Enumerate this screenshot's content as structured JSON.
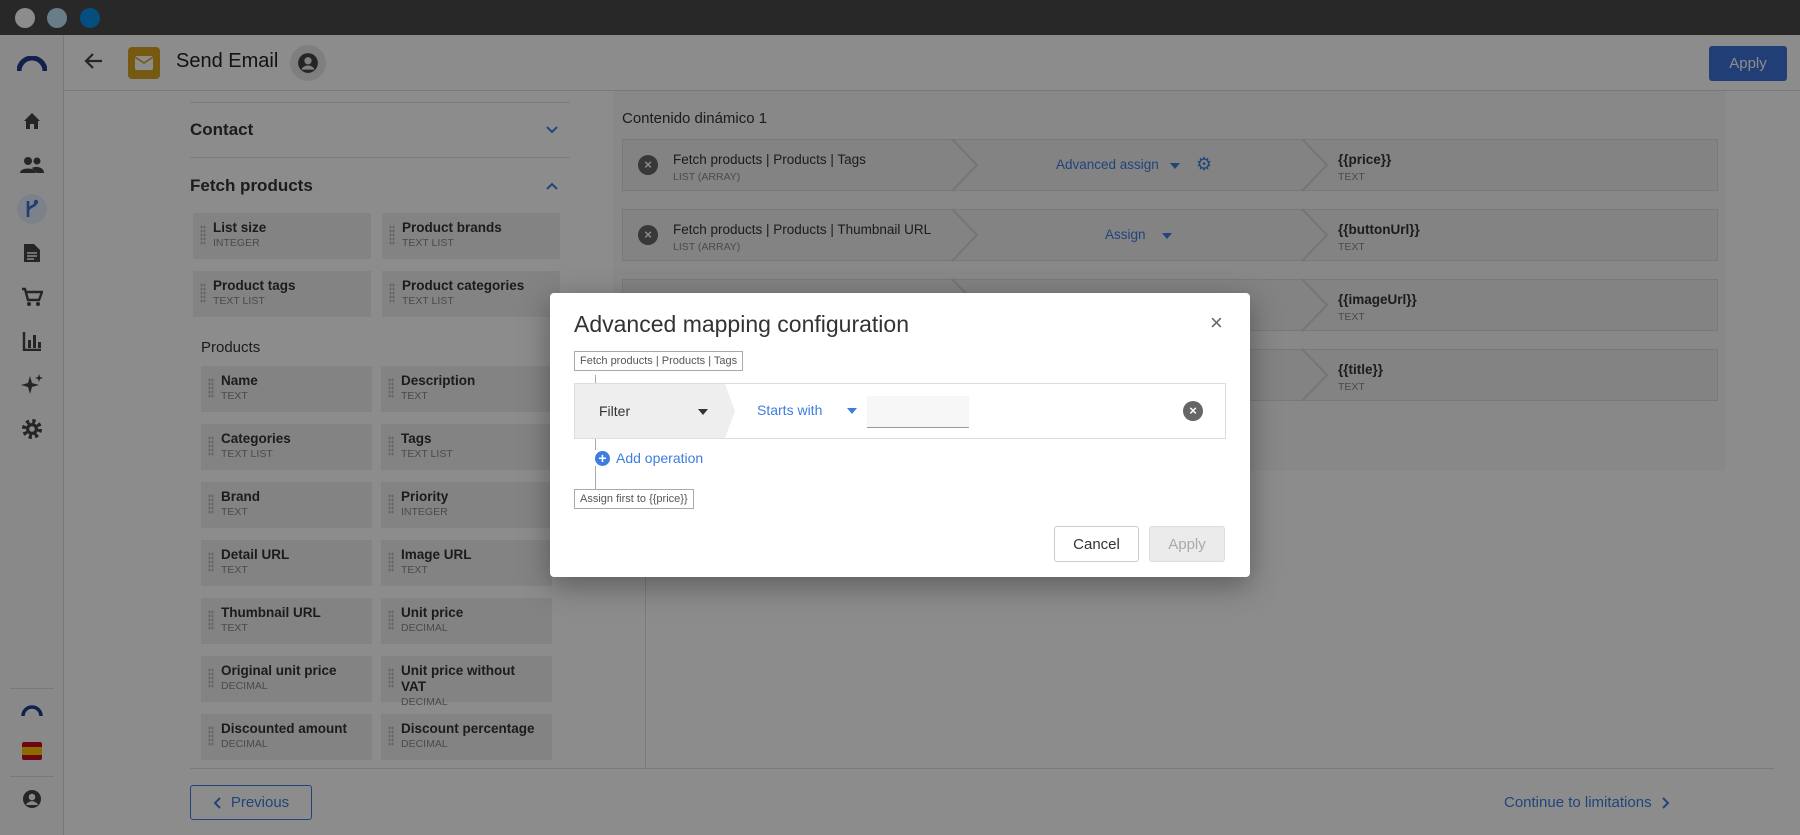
{
  "window": {
    "traffic_lights": [
      "#ffffff",
      "#bfe3f7",
      "#0a8fe8"
    ]
  },
  "sidebar": {
    "items": [
      {
        "icon": "logo-icon"
      },
      {
        "icon": "home-icon"
      },
      {
        "icon": "users-icon"
      },
      {
        "icon": "flow-icon"
      },
      {
        "icon": "document-icon"
      },
      {
        "icon": "cart-icon"
      },
      {
        "icon": "chart-icon"
      },
      {
        "icon": "sparkle-icon"
      },
      {
        "icon": "gear-icon"
      }
    ],
    "bottom": [
      {
        "icon": "brand-icon"
      },
      {
        "icon": "spain-flag-icon"
      },
      {
        "icon": "account-icon"
      }
    ]
  },
  "header": {
    "title": "Send Email",
    "apply_label": "Apply"
  },
  "left_panel": {
    "contact_label": "Contact",
    "fetch_label": "Fetch products",
    "fetch_fields": [
      {
        "name": "List size",
        "type": "INTEGER"
      },
      {
        "name": "Product brands",
        "type": "TEXT LIST"
      },
      {
        "name": "Product tags",
        "type": "TEXT LIST"
      },
      {
        "name": "Product categories",
        "type": "TEXT LIST"
      }
    ],
    "products_label": "Products",
    "product_fields": [
      {
        "name": "Name",
        "type": "TEXT"
      },
      {
        "name": "Description",
        "type": "TEXT"
      },
      {
        "name": "Categories",
        "type": "TEXT LIST"
      },
      {
        "name": "Tags",
        "type": "TEXT LIST"
      },
      {
        "name": "Brand",
        "type": "TEXT"
      },
      {
        "name": "Priority",
        "type": "INTEGER"
      },
      {
        "name": "Detail URL",
        "type": "TEXT"
      },
      {
        "name": "Image URL",
        "type": "TEXT"
      },
      {
        "name": "Thumbnail URL",
        "type": "TEXT"
      },
      {
        "name": "Unit price",
        "type": "DECIMAL"
      },
      {
        "name": "Original unit price",
        "type": "DECIMAL"
      },
      {
        "name": "Unit price without VAT",
        "type": "DECIMAL"
      },
      {
        "name": "Discounted amount",
        "type": "DECIMAL"
      },
      {
        "name": "Discount percentage",
        "type": "DECIMAL"
      }
    ]
  },
  "right_panel": {
    "section_title": "Contenido dinámico 1",
    "rows": [
      {
        "source": "Fetch products | Products | Tags",
        "source_type": "LIST (ARRAY)",
        "action": "Advanced assign",
        "target": "{{price}}",
        "target_type": "TEXT"
      },
      {
        "source": "Fetch products | Products | Thumbnail URL",
        "source_type": "LIST (ARRAY)",
        "action": "Assign",
        "target": "{{buttonUrl}}",
        "target_type": "TEXT"
      },
      {
        "source": "",
        "source_type": "",
        "action": "",
        "target": "{{imageUrl}}",
        "target_type": "TEXT"
      },
      {
        "source": "",
        "source_type": "",
        "action": "",
        "target": "{{title}}",
        "target_type": "TEXT"
      }
    ]
  },
  "footer": {
    "previous_label": "Previous",
    "continue_label": "Continue to limitations"
  },
  "modal": {
    "title": "Advanced mapping configuration",
    "source_tag": "Fetch products | Products | Tags",
    "operation_label": "Filter",
    "condition_label": "Starts with",
    "condition_value": "",
    "add_operation_label": "Add operation",
    "target_tag": "Assign first to {{price}}",
    "cancel_label": "Cancel",
    "apply_label": "Apply"
  }
}
